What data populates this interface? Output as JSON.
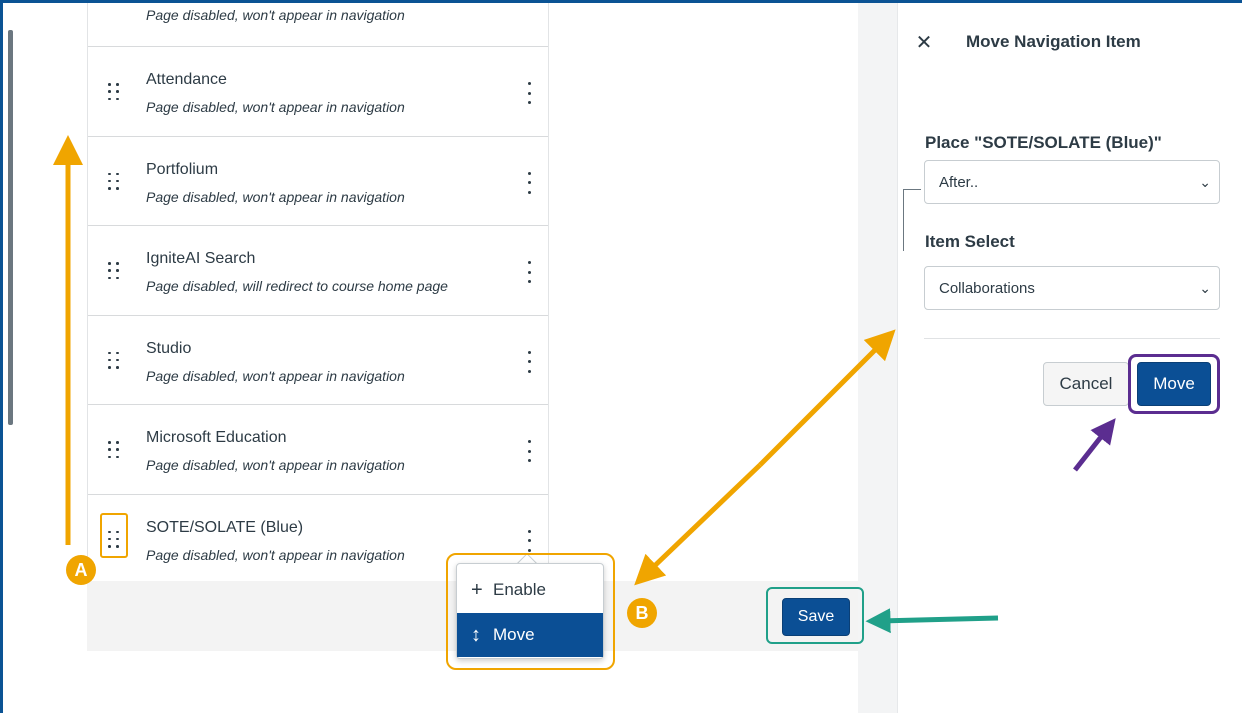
{
  "nav_items": [
    {
      "name": "Attendance",
      "status": "Page disabled, won't appear in navigation"
    },
    {
      "name": "Portfolium",
      "status": "Page disabled, won't appear in navigation"
    },
    {
      "name": "IgniteAI Search",
      "status": "Page disabled, will redirect to course home page"
    },
    {
      "name": "Studio",
      "status": "Page disabled, won't appear in navigation"
    },
    {
      "name": "Microsoft Education",
      "status": "Page disabled, won't appear in navigation"
    },
    {
      "name": "SOTE/SOLATE (Blue)",
      "status": "Page disabled, won't appear in navigation"
    }
  ],
  "partial_item_status": "Page disabled, won't appear in navigation",
  "context_menu": {
    "enable_label": "Enable",
    "enable_icon": "plus-icon",
    "move_label": "Move",
    "move_icon": "up-down-arrow-icon"
  },
  "footer": {
    "save_label": "Save"
  },
  "tray": {
    "title": "Move Navigation Item",
    "close_icon": "close-icon",
    "place_label": "Place \"SOTE/SOLATE (Blue)\"",
    "position_value": "After..",
    "item_select_label": "Item Select",
    "item_select_value": "Collaborations",
    "cancel_label": "Cancel",
    "move_label": "Move"
  },
  "annotations": {
    "marker_a": "A",
    "marker_b": "B",
    "orange": "#f0a500",
    "teal": "#20a089",
    "purple": "#5b2d90"
  }
}
